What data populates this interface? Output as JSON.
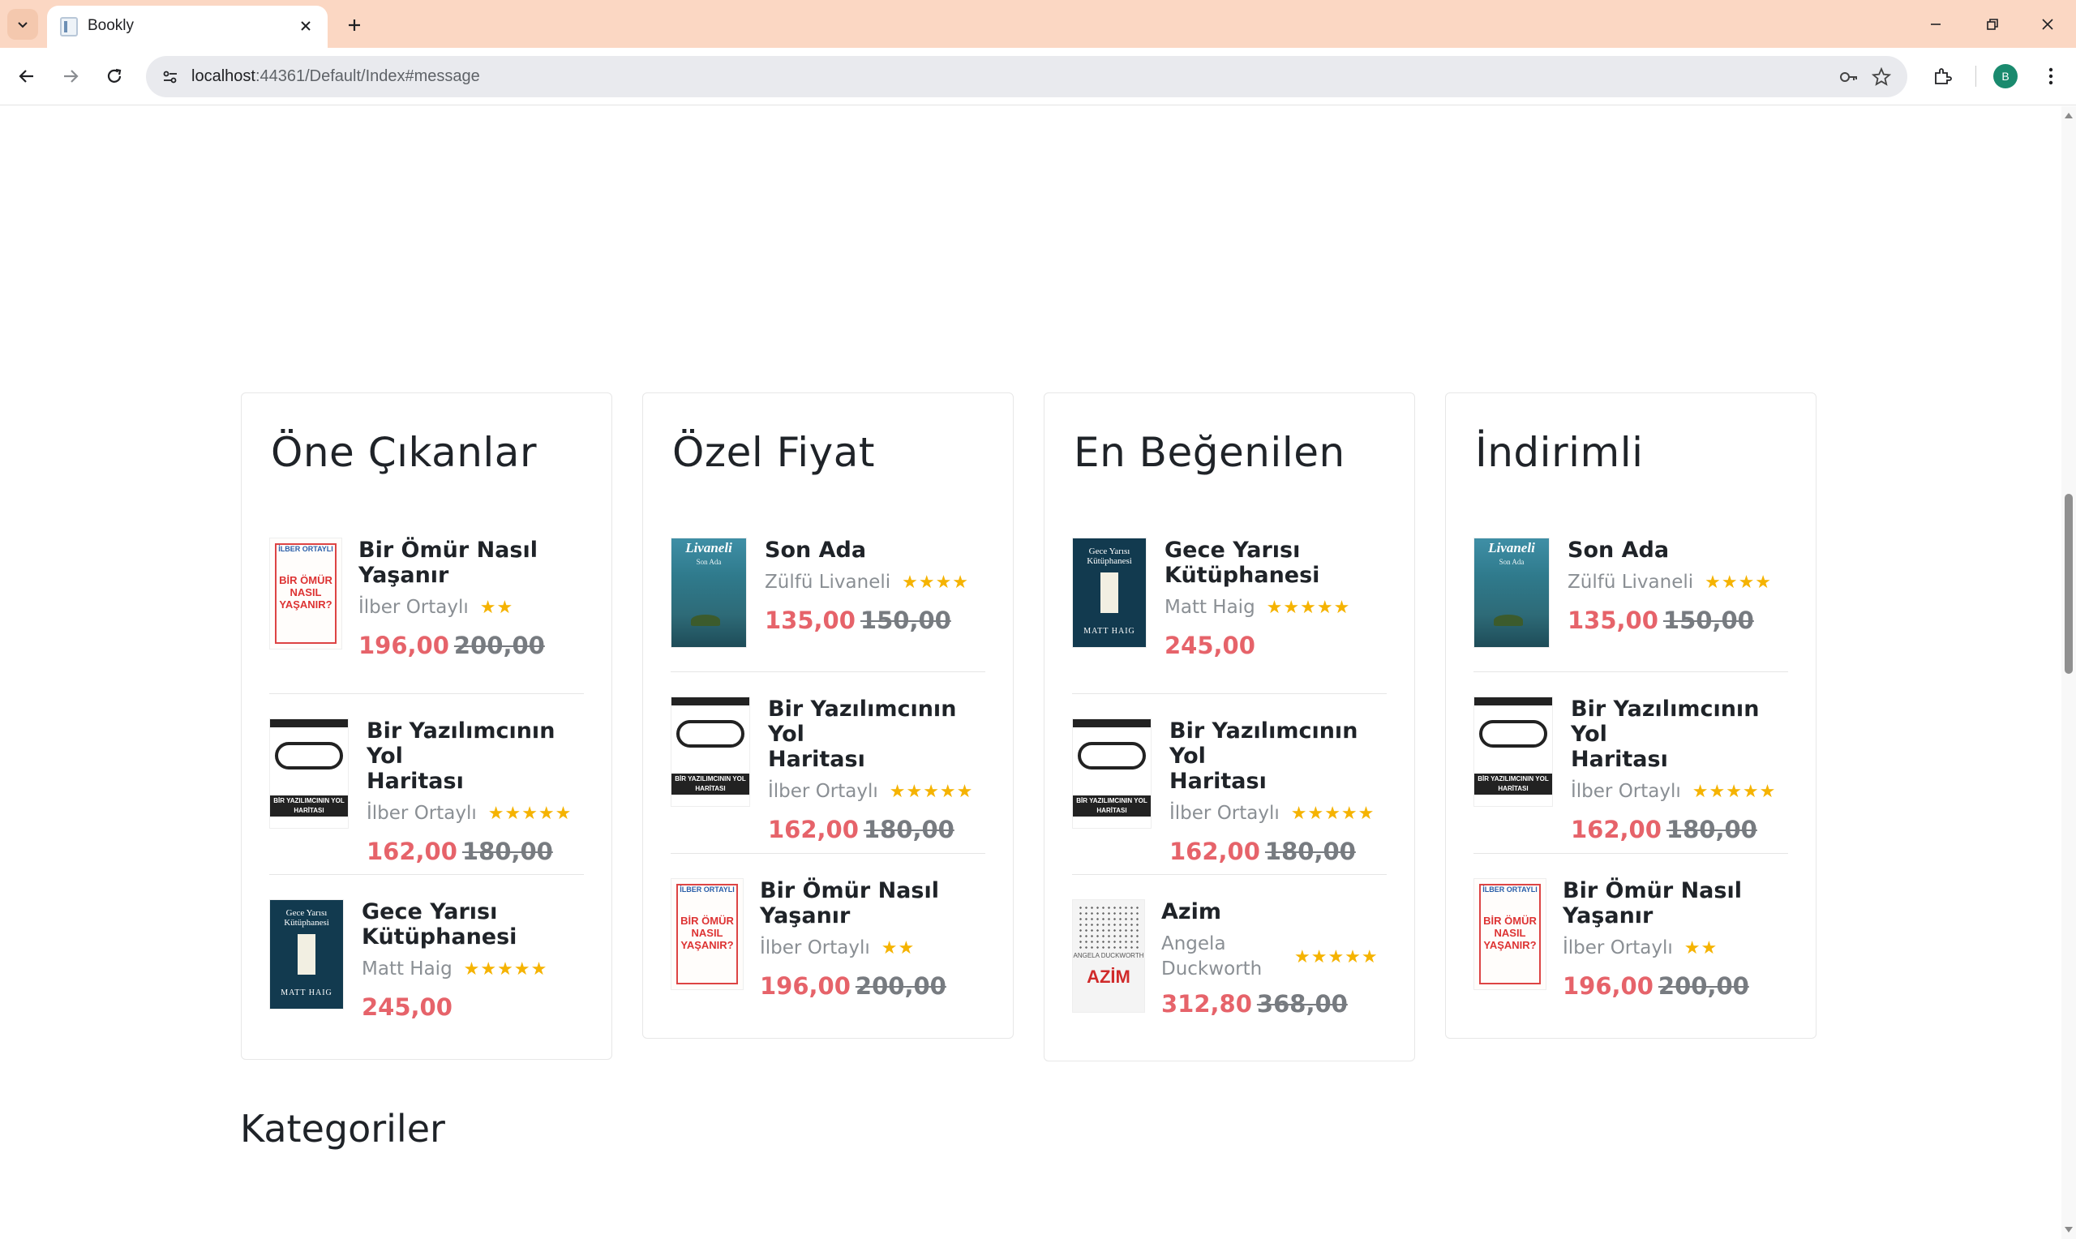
{
  "browser": {
    "tab_title": "Bookly",
    "url_host": "localhost",
    "url_rest": ":44361/Default/Index#message",
    "profile_initial": "B"
  },
  "colors": {
    "accent_price": "#e6636a",
    "star": "#f5b301",
    "chrome_tabbar": "#fbd7c3"
  },
  "cards": [
    {
      "title": "Öne Çıkanlar",
      "items": [
        {
          "title_line1": "Bir Ömür Nasıl",
          "title_line2": "Yaşanır",
          "author": "İlber Ortaylı",
          "stars": "★★",
          "rating": 2,
          "price": "196,00",
          "old_price": "200,00",
          "cover": "omur",
          "cover_text1": "İLBER ORTAYLI",
          "cover_text2": "BİR ÖMÜR NASIL YAŞANIR?"
        },
        {
          "title_line1": "Bir Yazılımcının Yol",
          "title_line2": "Haritası",
          "author": "İlber Ortaylı",
          "stars": "★★★★★",
          "rating": 5,
          "price": "162,00",
          "old_price": "180,00",
          "cover": "yazilim",
          "cover_text1": "BİR YAZILIMCININ YOL HARİTASI"
        },
        {
          "title_line1": "Gece Yarısı",
          "title_line2": "Kütüphanesi",
          "author": "Matt Haig",
          "stars": "★★★★★",
          "rating": 5,
          "price": "245,00",
          "old_price": "",
          "cover": "gece",
          "cover_text1": "Gece Yarısı Kütüphanesi",
          "cover_text2": "MATT HAIG"
        }
      ]
    },
    {
      "title": "Özel Fiyat",
      "items": [
        {
          "title_line1": "Son Ada",
          "title_line2": "",
          "author": "Zülfü Livaneli",
          "stars": "★★★★",
          "rating": 4,
          "price": "135,00",
          "old_price": "150,00",
          "cover": "livaneli",
          "cover_text1": "Livaneli",
          "cover_text2": "Son Ada"
        },
        {
          "title_line1": "Bir Yazılımcının Yol",
          "title_line2": "Haritası",
          "author": "İlber Ortaylı",
          "stars": "★★★★★",
          "rating": 5,
          "price": "162,00",
          "old_price": "180,00",
          "cover": "yazilim",
          "cover_text1": "BİR YAZILIMCININ YOL HARİTASI"
        },
        {
          "title_line1": "Bir Ömür Nasıl",
          "title_line2": "Yaşanır",
          "author": "İlber Ortaylı",
          "stars": "★★",
          "rating": 2,
          "price": "196,00",
          "old_price": "200,00",
          "cover": "omur",
          "cover_text1": "İLBER ORTAYLI",
          "cover_text2": "BİR ÖMÜR NASIL YAŞANIR?"
        }
      ]
    },
    {
      "title": "En Beğenilen",
      "items": [
        {
          "title_line1": "Gece Yarısı",
          "title_line2": "Kütüphanesi",
          "author": "Matt Haig",
          "stars": "★★★★★",
          "rating": 5,
          "price": "245,00",
          "old_price": "",
          "cover": "gece",
          "cover_text1": "Gece Yarısı Kütüphanesi",
          "cover_text2": "MATT HAIG"
        },
        {
          "title_line1": "Bir Yazılımcının Yol",
          "title_line2": "Haritası",
          "author": "İlber Ortaylı",
          "stars": "★★★★★",
          "rating": 5,
          "price": "162,00",
          "old_price": "180,00",
          "cover": "yazilim",
          "cover_text1": "BİR YAZILIMCININ YOL HARİTASI"
        },
        {
          "title_line1": "Azim",
          "title_line2": "",
          "author": "Angela Duckworth",
          "stars": "★★★★★",
          "rating": 5,
          "price": "312,80",
          "old_price": "368,00",
          "cover": "azim",
          "cover_text1": "ANGELA DUCKWORTH",
          "cover_text2": "AZİM"
        }
      ]
    },
    {
      "title": "İndirimli",
      "items": [
        {
          "title_line1": "Son Ada",
          "title_line2": "",
          "author": "Zülfü Livaneli",
          "stars": "★★★★",
          "rating": 4,
          "price": "135,00",
          "old_price": "150,00",
          "cover": "livaneli",
          "cover_text1": "Livaneli",
          "cover_text2": "Son Ada"
        },
        {
          "title_line1": "Bir Yazılımcının Yol",
          "title_line2": "Haritası",
          "author": "İlber Ortaylı",
          "stars": "★★★★★",
          "rating": 5,
          "price": "162,00",
          "old_price": "180,00",
          "cover": "yazilim",
          "cover_text1": "BİR YAZILIMCININ YOL HARİTASI"
        },
        {
          "title_line1": "Bir Ömür Nasıl",
          "title_line2": "Yaşanır",
          "author": "İlber Ortaylı",
          "stars": "★★",
          "rating": 2,
          "price": "196,00",
          "old_price": "200,00",
          "cover": "omur",
          "cover_text1": "İLBER ORTAYLI",
          "cover_text2": "BİR ÖMÜR NASIL YAŞANIR?"
        }
      ]
    }
  ],
  "next_section_title": "Kategoriler"
}
